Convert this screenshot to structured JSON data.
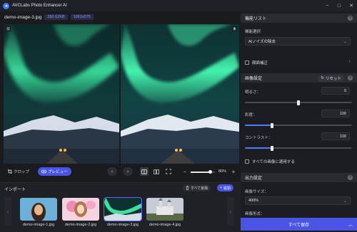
{
  "app": {
    "title": "AVCLabs Photo Enhancer AI"
  },
  "window": {
    "minimize": "−",
    "maximize": "□",
    "close": "✕"
  },
  "file": {
    "name": "demo-image-3.jpg",
    "size": "350.62KB",
    "resolution": "1061x575"
  },
  "panes": {
    "left_tag": "前",
    "right_tag": "後"
  },
  "toolbar": {
    "crop": "クロップ",
    "preview": "プレビュー",
    "zoom": "80%",
    "zoom_level": 0.8
  },
  "import": {
    "title": "インポート",
    "clear": "すべて削除",
    "add": "追加",
    "items": [
      {
        "label": "demo-image-1.jpg",
        "selected": false
      },
      {
        "label": "demo-image-2.jpg",
        "selected": false
      },
      {
        "label": "demo-image-3.jpg",
        "selected": true
      },
      {
        "label": "demo-image-4.jpg",
        "selected": false
      }
    ]
  },
  "features": {
    "title": "機能リスト",
    "select_label": "機能選択",
    "select_value": "AIノイズの除去",
    "face_fix": "顔面補正"
  },
  "image_settings": {
    "title": "画像設定",
    "reset": "リセット",
    "brightness_label": "明るさ：",
    "brightness_value": "0",
    "brightness_level": 0.5,
    "saturation_label": "彩度：",
    "saturation_value": "100",
    "saturation_level": 0.25,
    "contrast_label": "コントラスト：",
    "contrast_value": "100",
    "contrast_level": 0.25,
    "apply_all": "すべての画像に適用する"
  },
  "output": {
    "title": "出力設定",
    "size_label": "画像サイズ：",
    "size_value": "400%",
    "format_label": "画像形式：",
    "save": "すべて保存"
  },
  "colors": {
    "accent": "#4a55e8",
    "slider": "#4a7cf5",
    "aurora": "#3ff5a8"
  }
}
